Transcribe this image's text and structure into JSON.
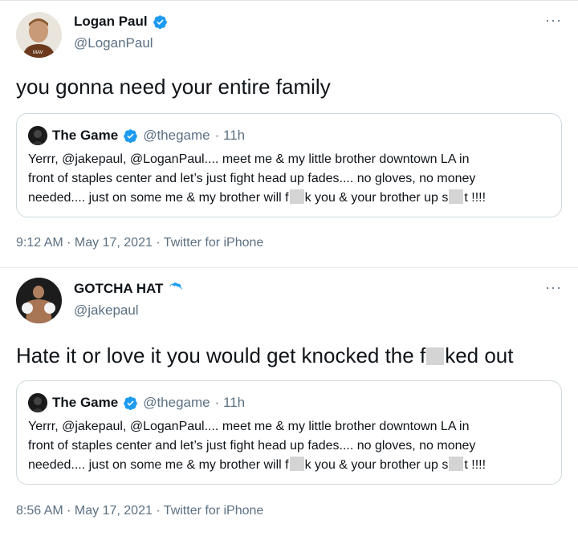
{
  "tweets": [
    {
      "author": {
        "name": "Logan Paul",
        "handle": "@LoganPaul",
        "verified": true
      },
      "text": "you gonna need your entire family",
      "quote": {
        "name": "The Game",
        "handle": "@thegame",
        "time": "· 11h",
        "line1": "Yerrr, @jakepaul, @LoganPaul.... meet me & my little brother downtown LA in",
        "line2": "front of staples center and let’s just fight head up fades.... no gloves, no money",
        "line3a": "needed.... just on some me & my brother will f",
        "line3b": "k you & your brother up s",
        "line3c": "t !!!!"
      },
      "meta": "9:12 AM · May 17, 2021 · Twitter for iPhone"
    },
    {
      "author": {
        "name": "GOTCHA HAT",
        "handle": "@jakepaul",
        "verified": true
      },
      "text_a": "Hate it or love it you would get knocked the f",
      "text_b": "ked out",
      "quote": {
        "name": "The Game",
        "handle": "@thegame",
        "time": "· 11h",
        "line1": "Yerrr, @jakepaul, @LoganPaul.... meet me & my little brother downtown LA in",
        "line2": "front of staples center and let’s just fight head up fades.... no gloves, no money",
        "line3a": "needed.... just on some me & my brother will f",
        "line3b": "k you & your brother up s",
        "line3c": "t !!!!"
      },
      "meta": "8:56 AM · May 17, 2021 · Twitter for iPhone"
    }
  ],
  "more_label": "···",
  "colors": {
    "verified": "#1d9bf0",
    "secondary": "#5b7083",
    "border": "#cfd9de"
  }
}
